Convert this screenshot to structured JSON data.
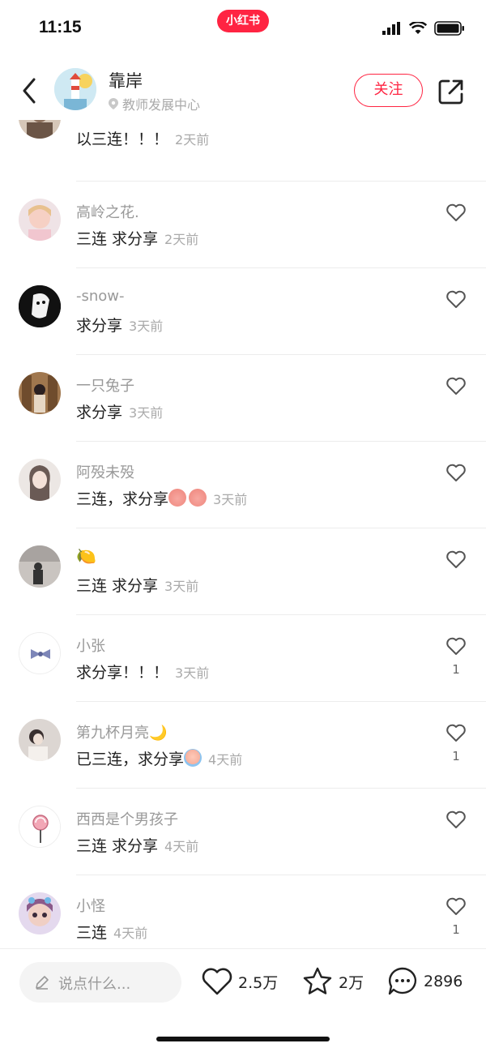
{
  "status_bar": {
    "time": "11:15",
    "app_badge": "小红书"
  },
  "header": {
    "name": "靠岸",
    "location": "教师发展中心",
    "follow_label": "关注"
  },
  "comments": [
    {
      "name": "",
      "text": "以三连！！！",
      "time": "2天前",
      "likes": ""
    },
    {
      "name": "高岭之花.",
      "text": "三连 求分享",
      "time": "2天前",
      "likes": ""
    },
    {
      "name": "-snow-",
      "text": "求分享",
      "time": "3天前",
      "likes": ""
    },
    {
      "name": "一只兔子",
      "text": "求分享",
      "time": "3天前",
      "likes": ""
    },
    {
      "name": "阿殁未殁",
      "text": "三连，求分享",
      "time": "3天前",
      "likes": ""
    },
    {
      "name": "🍋",
      "text": "三连 求分享",
      "time": "3天前",
      "likes": ""
    },
    {
      "name": "小张",
      "text": "求分享！！！",
      "time": "3天前",
      "likes": "1"
    },
    {
      "name": "第九杯月亮🌙",
      "text": "已三连，求分享",
      "time": "4天前",
      "likes": "1"
    },
    {
      "name": "西西是个男孩子",
      "text": "三连  求分享",
      "time": "4天前",
      "likes": ""
    },
    {
      "name": "小怪",
      "text": "三连",
      "time": "4天前",
      "likes": "1"
    }
  ],
  "bottom_bar": {
    "input_placeholder": "说点什么...",
    "likes": "2.5万",
    "collects": "2万",
    "comments": "2896"
  },
  "colors": {
    "accent": "#ff2442",
    "text_primary": "#222222",
    "text_secondary": "#999999"
  },
  "icons": [
    "back-icon",
    "location-icon",
    "share-icon",
    "heart-icon",
    "star-icon",
    "comment-icon",
    "pen-icon",
    "signal-icon",
    "wifi-icon",
    "battery-icon"
  ]
}
